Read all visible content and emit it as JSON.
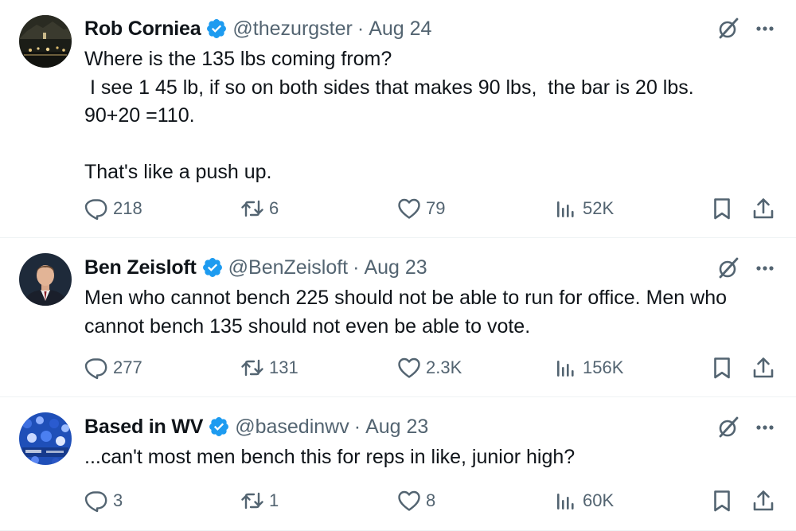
{
  "colors": {
    "verified": "#1d9bf0",
    "text": "#0f1419",
    "muted": "#536471"
  },
  "tweets": [
    {
      "name": "Rob Corniea",
      "handle": "@thezurgster",
      "separator": "·",
      "date": "Aug 24",
      "lines": [
        "Where is the 135 lbs coming from?",
        " I see 1 45 lb, if so on both sides that makes 90 lbs,  the bar is 20 lbs.",
        "90+20 =110.",
        "",
        "That's like a push up."
      ],
      "replies": "218",
      "reposts": "6",
      "likes": "79",
      "views": "52K"
    },
    {
      "name": "Ben Zeisloft",
      "handle": "@BenZeisloft",
      "separator": "·",
      "date": "Aug 23",
      "lines": [
        "Men who cannot bench 225 should not be able to run for office. Men who",
        "cannot bench 135 should not even be able to vote."
      ],
      "replies": "277",
      "reposts": "131",
      "likes": "2.3K",
      "views": "156K"
    },
    {
      "name": "Based in WV",
      "handle": "@basedinwv",
      "separator": "·",
      "date": "Aug 23",
      "lines": [
        "...can't most men bench this for reps in like, junior high?"
      ],
      "replies": "3",
      "reposts": "1",
      "likes": "8",
      "views": "60K"
    }
  ],
  "icons": {
    "avatar_1": "night-street-photo-avatar",
    "avatar_2": "man-in-suit-avatar",
    "avatar_3": "crowd-blue-avatar",
    "verified": "verified-badge-icon",
    "grok": "grok-icon",
    "more": "more-icon",
    "reply": "reply-icon",
    "repost": "repost-icon",
    "like": "like-icon",
    "views": "views-icon",
    "bookmark": "bookmark-icon",
    "share": "share-icon"
  }
}
